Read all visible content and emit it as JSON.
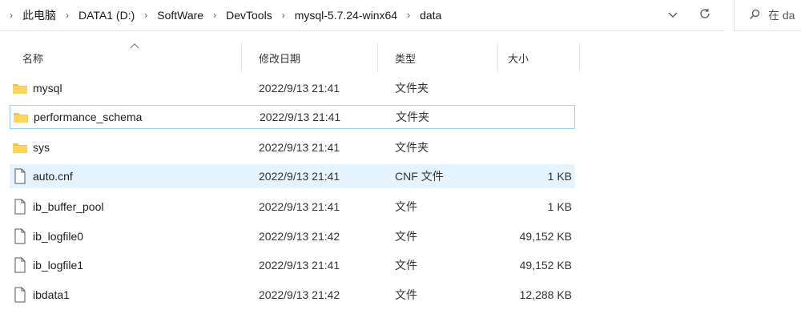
{
  "address_bar": {
    "crumbs": [
      "此电脑",
      "DATA1 (D:)",
      "SoftWare",
      "DevTools",
      "mysql-5.7.24-winx64",
      "data"
    ],
    "search_placeholder": "在 da"
  },
  "columns": {
    "name": "名称",
    "date": "修改日期",
    "type": "类型",
    "size": "大小"
  },
  "files": [
    {
      "name": "mysql",
      "date": "2022/9/13 21:41",
      "type": "文件夹",
      "size": "",
      "icon": "folder-icon"
    },
    {
      "name": "performance_schema",
      "date": "2022/9/13 21:41",
      "type": "文件夹",
      "size": "",
      "icon": "folder-icon"
    },
    {
      "name": "sys",
      "date": "2022/9/13 21:41",
      "type": "文件夹",
      "size": "",
      "icon": "folder-icon"
    },
    {
      "name": "auto.cnf",
      "date": "2022/9/13 21:41",
      "type": "CNF 文件",
      "size": "1 KB",
      "icon": "file-icon"
    },
    {
      "name": "ib_buffer_pool",
      "date": "2022/9/13 21:41",
      "type": "文件",
      "size": "1 KB",
      "icon": "file-icon"
    },
    {
      "name": "ib_logfile0",
      "date": "2022/9/13 21:42",
      "type": "文件",
      "size": "49,152 KB",
      "icon": "file-icon"
    },
    {
      "name": "ib_logfile1",
      "date": "2022/9/13 21:41",
      "type": "文件",
      "size": "49,152 KB",
      "icon": "file-icon"
    },
    {
      "name": "ibdata1",
      "date": "2022/9/13 21:42",
      "type": "文件",
      "size": "12,288 KB",
      "icon": "file-icon"
    }
  ],
  "colors": {
    "hover_bg": "#e5f3ff",
    "focus_border": "#99d1ff",
    "folder": "#f8c447"
  }
}
